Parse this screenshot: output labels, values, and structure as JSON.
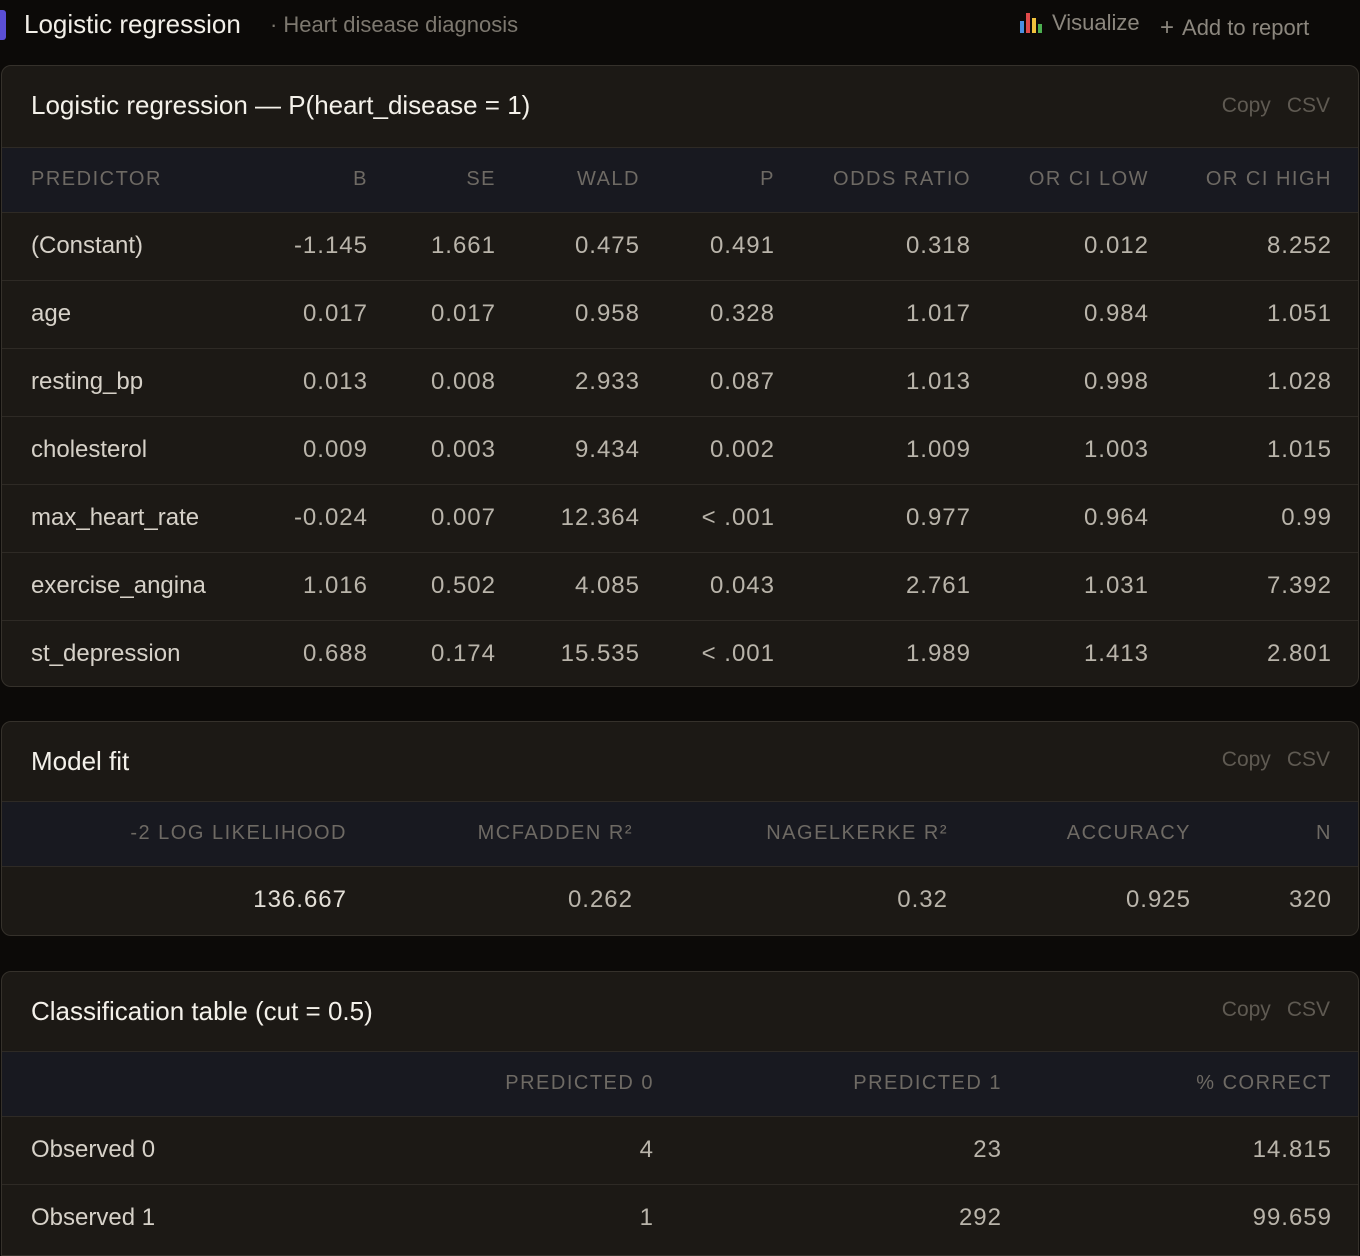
{
  "header": {
    "title": "Logistic regression",
    "subtitle": "Heart disease diagnosis",
    "visualize_label": "Visualize",
    "add_to_report_label": "Add to report"
  },
  "panels": {
    "actions": {
      "copy": "Copy",
      "csv": "CSV"
    },
    "coefficients": {
      "title": "Logistic regression — P(heart_disease = 1)",
      "columns": [
        "PREDICTOR",
        "B",
        "SE",
        "WALD",
        "P",
        "ODDS RATIO",
        "OR CI LOW",
        "OR CI HIGH"
      ],
      "rows": [
        [
          "(Constant)",
          "-1.145",
          "1.661",
          "0.475",
          "0.491",
          "0.318",
          "0.012",
          "8.252"
        ],
        [
          "age",
          "0.017",
          "0.017",
          "0.958",
          "0.328",
          "1.017",
          "0.984",
          "1.051"
        ],
        [
          "resting_bp",
          "0.013",
          "0.008",
          "2.933",
          "0.087",
          "1.013",
          "0.998",
          "1.028"
        ],
        [
          "cholesterol",
          "0.009",
          "0.003",
          "9.434",
          "0.002",
          "1.009",
          "1.003",
          "1.015"
        ],
        [
          "max_heart_rate",
          "-0.024",
          "0.007",
          "12.364",
          "< .001",
          "0.977",
          "0.964",
          "0.99"
        ],
        [
          "exercise_angina",
          "1.016",
          "0.502",
          "4.085",
          "0.043",
          "2.761",
          "1.031",
          "7.392"
        ],
        [
          "st_depression",
          "0.688",
          "0.174",
          "15.535",
          "< .001",
          "1.989",
          "1.413",
          "2.801"
        ]
      ]
    },
    "model_fit": {
      "title": "Model fit",
      "columns": [
        "-2 LOG LIKELIHOOD",
        "MCFADDEN R²",
        "NAGELKERKE R²",
        "ACCURACY",
        "N"
      ],
      "rows": [
        [
          "136.667",
          "0.262",
          "0.32",
          "0.925",
          "320"
        ]
      ]
    },
    "classification": {
      "title": "Classification table (cut = 0.5)",
      "columns": [
        "",
        "PREDICTED 0",
        "PREDICTED 1",
        "% CORRECT"
      ],
      "rows": [
        [
          "Observed 0",
          "4",
          "23",
          "14.815"
        ],
        [
          "Observed 1",
          "1",
          "292",
          "99.659"
        ]
      ]
    }
  },
  "colors": {
    "accent": "#5b4fd6",
    "background": "#0c0a08",
    "panel": "#1c1915",
    "header_row": "#181920"
  },
  "icons": {
    "visualize": "bar-chart-icon",
    "add": "plus-icon"
  }
}
